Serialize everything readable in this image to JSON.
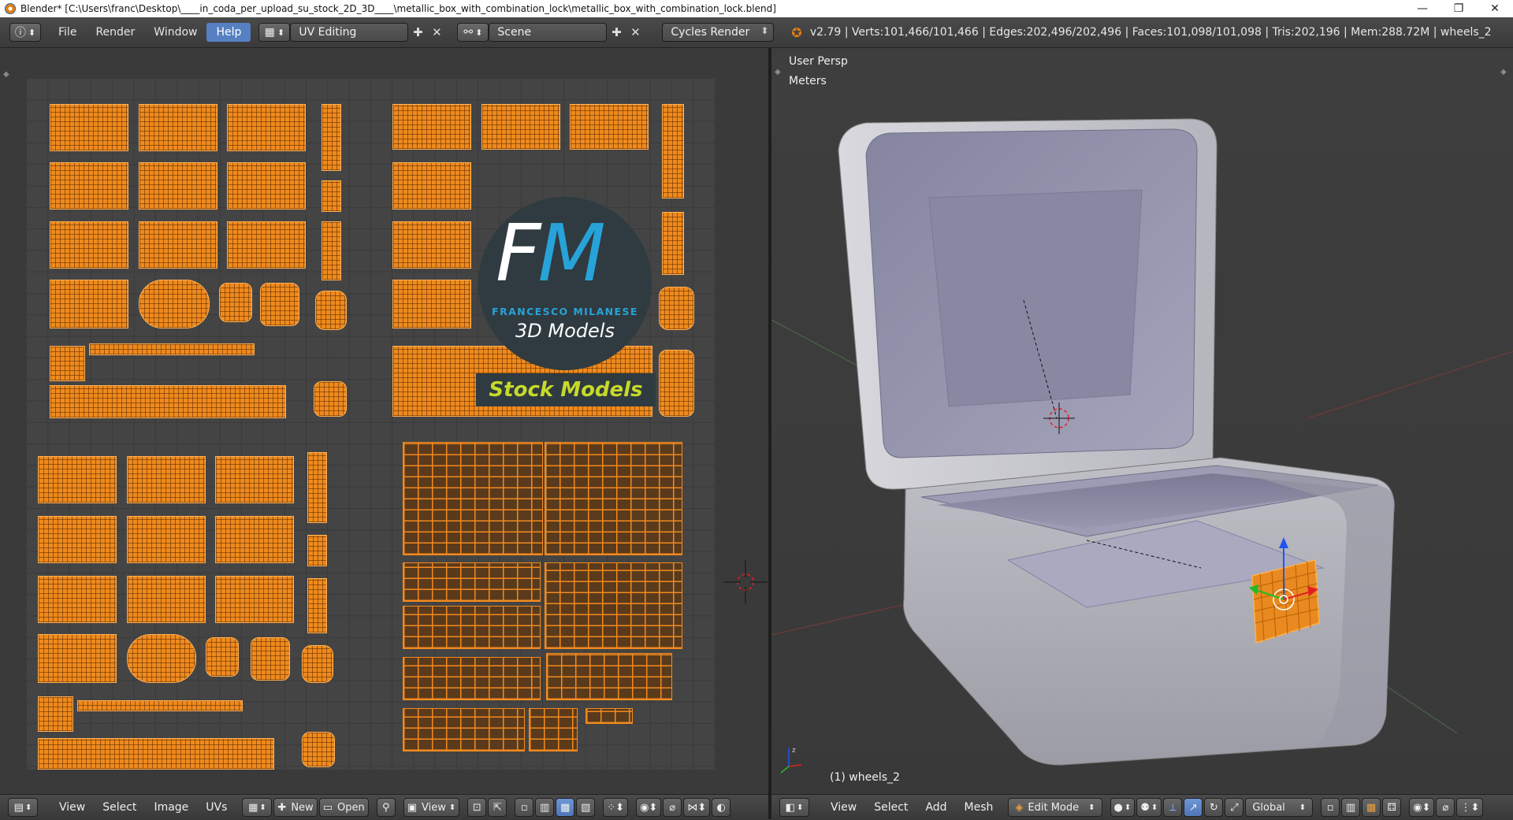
{
  "window": {
    "title": "Blender* [C:\\Users\\franc\\Desktop\\____in_coda_per_upload_su_stock_2D_3D____\\metallic_box_with_combination_lock\\metallic_box_with_combination_lock.blend]",
    "minimize": "—",
    "maximize": "❐",
    "close": "✕"
  },
  "infobar": {
    "menus": [
      "File",
      "Render",
      "Window",
      "Help"
    ],
    "active_menu": "Help",
    "screen_layout": "UV Editing",
    "scene": "Scene",
    "render_engine": "Cycles Render",
    "stats": "v2.79 | Verts:101,466/101,466 | Edges:202,496/202,496 | Faces:101,098/101,098 | Tris:202,196 | Mem:288.72M | wheels_2"
  },
  "uv_editor": {
    "logo": {
      "initials_f": "F",
      "initials_m": "M",
      "author": "FRANCESCO MILANESE",
      "subtitle": "3D Models",
      "tag": "Stock Models"
    },
    "footer": {
      "menus": [
        "View",
        "Select",
        "Image",
        "UVs"
      ],
      "new_label": "New",
      "open_label": "Open",
      "view_label": "View"
    }
  },
  "view3d": {
    "view_name": "User Persp",
    "units": "Meters",
    "object_label": "(1) wheels_2",
    "footer": {
      "menus": [
        "View",
        "Select",
        "Add",
        "Mesh"
      ],
      "mode": "Edit Mode",
      "orientation": "Global"
    }
  },
  "colors": {
    "uv_orange": "#ee8a1d",
    "logo_blue": "#27a3d9",
    "logo_green": "#c7d92a",
    "active_blue": "#5680c2"
  }
}
